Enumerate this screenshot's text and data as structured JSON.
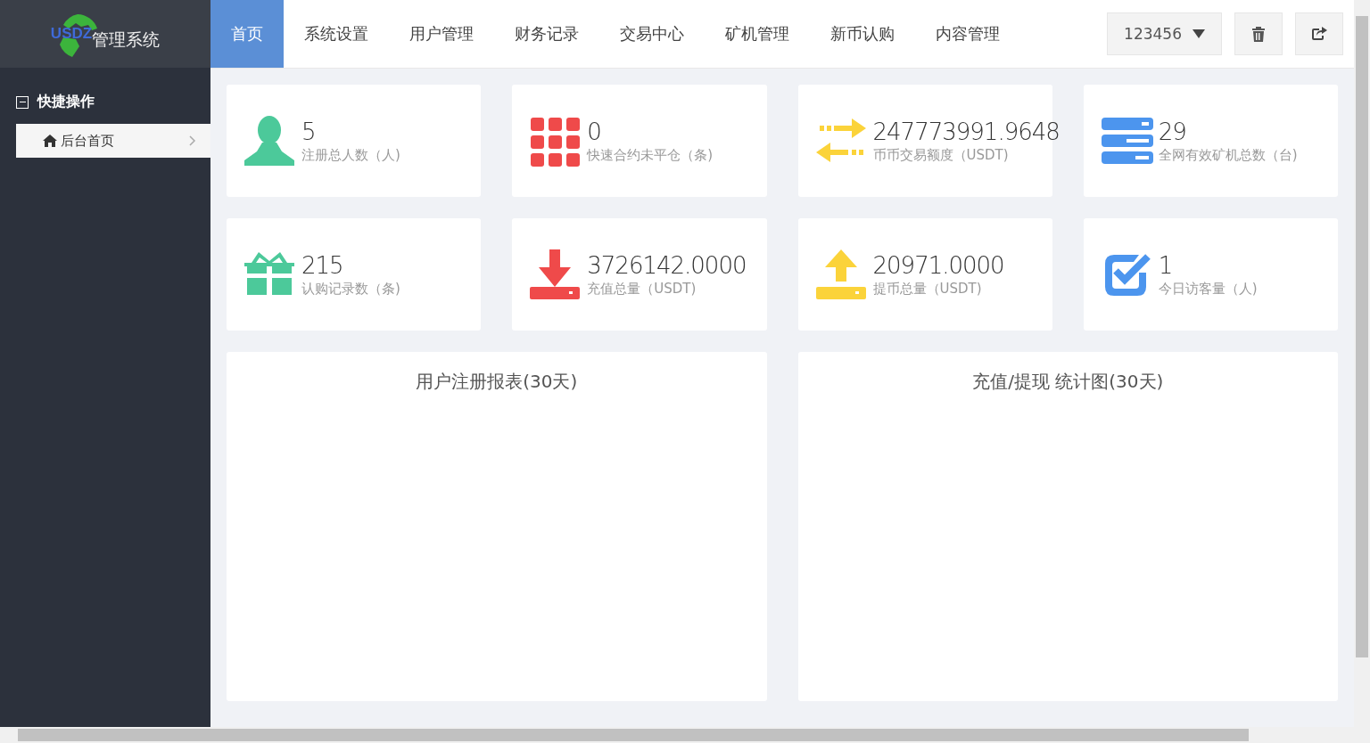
{
  "logo": {
    "mark": "USDZ",
    "title": "管理系统"
  },
  "nav": [
    {
      "label": "首页",
      "selected": true
    },
    {
      "label": "系统设置",
      "selected": false
    },
    {
      "label": "用户管理",
      "selected": false
    },
    {
      "label": "财务记录",
      "selected": false
    },
    {
      "label": "交易中心",
      "selected": false
    },
    {
      "label": "矿机管理",
      "selected": false
    },
    {
      "label": "新币认购",
      "selected": false
    },
    {
      "label": "内容管理",
      "selected": false
    }
  ],
  "user_menu": {
    "label": "123456"
  },
  "sidebar": {
    "section": {
      "label": "快捷操作",
      "expanded": true
    },
    "items": [
      {
        "label": "后台首页",
        "selected": true
      }
    ]
  },
  "stats": [
    {
      "kind": "person",
      "color": "#4cc99a",
      "value": "5",
      "label": "注册总人数（人)"
    },
    {
      "kind": "grid",
      "color": "#ef4a4a",
      "value": "0",
      "label": "快速合约未平仓（条)"
    },
    {
      "kind": "exchange",
      "color": "#fbd33a",
      "value": "247773991.9648",
      "label": "币币交易额度（USDT)"
    },
    {
      "kind": "server",
      "color": "#4c95ee",
      "value": "29",
      "label": "全网有效矿机总数（台)"
    },
    {
      "kind": "gift",
      "color": "#4cc99a",
      "value": "215",
      "label": "认购记录数（条)"
    },
    {
      "kind": "download",
      "color": "#ef4a4a",
      "value": "3726142.0000",
      "label": "充值总量（USDT)"
    },
    {
      "kind": "upload",
      "color": "#fbd33a",
      "value": "20971.0000",
      "label": "提币总量（USDT)"
    },
    {
      "kind": "check",
      "color": "#4c95ee",
      "value": "1",
      "label": "今日访客量（人)"
    }
  ],
  "panels": [
    {
      "title": "用户注册报表(30天)"
    },
    {
      "title": "充值/提现 统计图(30天)"
    }
  ]
}
